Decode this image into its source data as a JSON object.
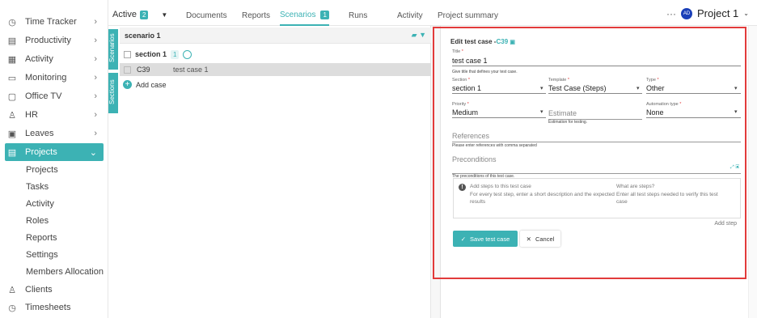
{
  "colors": {
    "accent": "#3cb2b4",
    "highlight_border": "#e23b3b",
    "avatar": "#1a3fb8"
  },
  "sidebar": {
    "items": [
      {
        "label": "Time Tracker",
        "icon": "clock-icon"
      },
      {
        "label": "Productivity",
        "icon": "chart-icon"
      },
      {
        "label": "Activity",
        "icon": "activity-icon"
      },
      {
        "label": "Monitoring",
        "icon": "monitor-icon"
      },
      {
        "label": "Office TV",
        "icon": "tv-icon"
      },
      {
        "label": "HR",
        "icon": "person-icon"
      },
      {
        "label": "Leaves",
        "icon": "calendar-icon"
      },
      {
        "label": "Projects",
        "icon": "briefcase-icon"
      }
    ],
    "sub_items": [
      "Projects",
      "Tasks",
      "Activity",
      "Roles",
      "Reports",
      "Settings",
      "Members Allocation"
    ],
    "bottom_items": [
      {
        "label": "Clients",
        "icon": "person-icon"
      },
      {
        "label": "Timesheets",
        "icon": "timer-icon"
      }
    ]
  },
  "topbar": {
    "active_label": "Active",
    "active_count": "2",
    "tabs": [
      "Documents",
      "Reports",
      "Scenarios",
      "Runs",
      "Activity"
    ],
    "scenarios_count": "1",
    "project_summary": "Project summary",
    "more": "···",
    "avatar_initials": "AD",
    "project_name": "Project 1"
  },
  "vertical_tabs": [
    "Scenarios",
    "Sections"
  ],
  "scenario": {
    "name": "scenario 1",
    "section_name": "section 1",
    "section_count": "1",
    "case_id": "C39",
    "case_name": "test case 1",
    "add_case": "Add case"
  },
  "editor": {
    "heading": "Edit test case -",
    "case_id": "C39",
    "title_label": "Title",
    "title_value": "test case 1",
    "title_hint": "Give title that defines your test case.",
    "section_label": "Section",
    "section_value": "section 1",
    "template_label": "Template",
    "template_value": "Test Case (Steps)",
    "type_label": "Type",
    "type_value": "Other",
    "priority_label": "Priority",
    "priority_value": "Medium",
    "estimate_placeholder": "Estimate",
    "estimate_hint": "Estimation for testing.",
    "automation_label": "Automation type",
    "automation_value": "None",
    "references_placeholder": "References",
    "references_hint": "Please enter references with comma separated",
    "preconditions_placeholder": "Preconditions",
    "preconditions_hint": "The preconditions of this test case.",
    "steps_col1_title": "Add steps to this test case",
    "steps_col1_text": "For every test step, enter a short description and the expected results",
    "steps_col2_title": "What are steps?",
    "steps_col2_text": "Enter all test steps needed to verify this test case",
    "add_step": "Add step",
    "save_label": "Save test case",
    "cancel_label": "Cancel"
  }
}
